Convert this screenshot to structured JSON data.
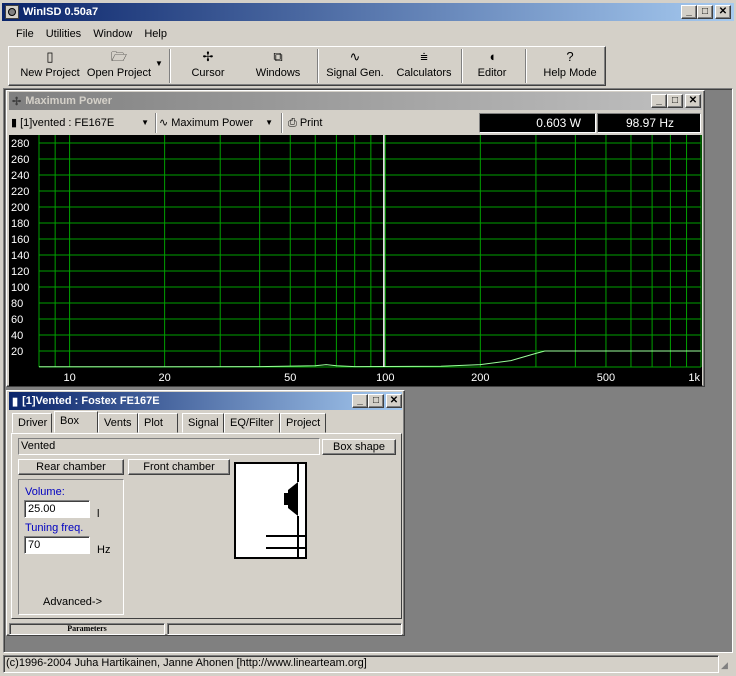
{
  "app": {
    "title": "WinISD 0.50a7"
  },
  "menu": [
    {
      "label": "File"
    },
    {
      "label": "Utilities"
    },
    {
      "label": "Window"
    },
    {
      "label": "Help"
    }
  ],
  "toolbar": {
    "new_project": "New Project",
    "open_project": "Open Project",
    "cursor": "Cursor",
    "windows": "Windows",
    "signal_gen": "Signal Gen.",
    "calculators": "Calculators",
    "editor": "Editor",
    "help_mode": "Help Mode"
  },
  "plot_window": {
    "title": "Maximum Power",
    "project_select": "[1]vented : FE167E",
    "graph_select": "Maximum Power",
    "print": "Print",
    "readout_power": "0.603 W",
    "readout_freq": "98.97 Hz"
  },
  "chart_data": {
    "type": "line",
    "title": "",
    "xscale": "log",
    "xlim": [
      8,
      1000
    ],
    "ylim": [
      0,
      290
    ],
    "x_tick_labels": [
      {
        "v": 10,
        "t": "10"
      },
      {
        "v": 20,
        "t": "20"
      },
      {
        "v": 50,
        "t": "50"
      },
      {
        "v": 100,
        "t": "100"
      },
      {
        "v": 200,
        "t": "200"
      },
      {
        "v": 500,
        "t": "500"
      },
      {
        "v": 1000,
        "t": "1k"
      }
    ],
    "y_tick_labels": [
      "20",
      "40",
      "60",
      "80",
      "100",
      "120",
      "140",
      "160",
      "180",
      "200",
      "220",
      "240",
      "260",
      "280"
    ],
    "y_ticks": [
      20,
      40,
      60,
      80,
      100,
      120,
      140,
      160,
      180,
      200,
      220,
      240,
      260,
      280
    ],
    "grid": true,
    "cursor_x": 98.97,
    "series": [
      {
        "x": [
          8,
          20,
          40,
          60,
          65,
          70,
          80,
          100,
          150,
          200,
          250,
          300,
          320,
          500,
          1000
        ],
        "y": [
          0.3,
          0.3,
          0.5,
          1.5,
          3,
          1.5,
          0.5,
          0.6,
          1,
          3,
          8,
          17,
          20,
          20,
          20
        ]
      }
    ],
    "colors": {
      "background": "#000000",
      "grid": "#00a000",
      "line": "#9aff9a",
      "cursor": "#ffffff"
    }
  },
  "project_window": {
    "title": "[1]Vented : Fostex  FE167E",
    "tabs": [
      "Driver",
      "Box",
      "Vents",
      "Plot",
      "Signal",
      "EQ/Filter",
      "Project"
    ],
    "active_tab": "Box",
    "box_type": "Vented",
    "box_shape_button": "Box shape",
    "rear_chamber": "Rear chamber",
    "front_chamber": "Front chamber",
    "volume_label": "Volume:",
    "volume_value": "25.00",
    "volume_unit": "l",
    "tuning_label": "Tuning freq.",
    "tuning_value": "70",
    "tuning_unit": "Hz",
    "advanced": "Advanced->",
    "status_panel": "Parameters"
  },
  "statusbar": {
    "text": "(c)1996-2004 Juha Hartikainen, Janne Ahonen [http://www.linearteam.org]"
  }
}
